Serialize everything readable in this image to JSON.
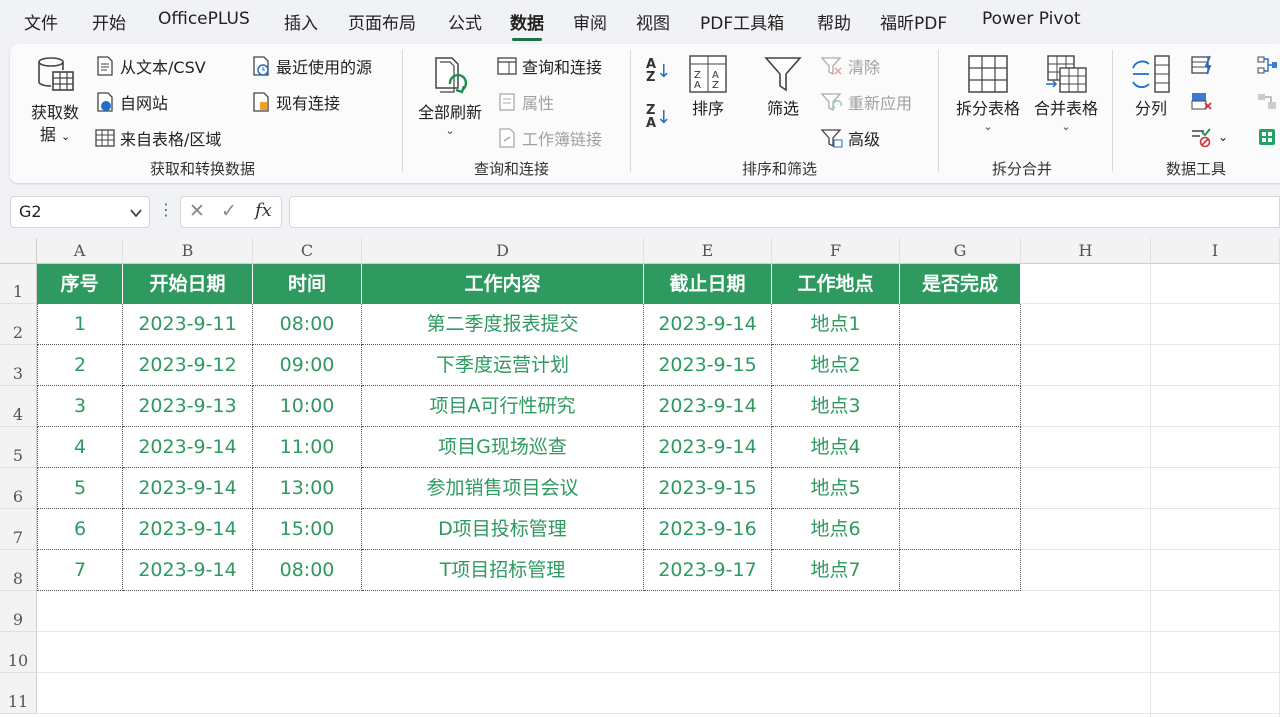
{
  "menu": [
    {
      "label": "文件"
    },
    {
      "label": "开始"
    },
    {
      "label": "OfficePLUS"
    },
    {
      "label": "插入"
    },
    {
      "label": "页面布局"
    },
    {
      "label": "公式"
    },
    {
      "label": "数据",
      "active": true
    },
    {
      "label": "审阅"
    },
    {
      "label": "视图"
    },
    {
      "label": "PDF工具箱"
    },
    {
      "label": "帮助"
    },
    {
      "label": "福昕PDF"
    },
    {
      "label": "Power Pivot"
    }
  ],
  "ribbon": {
    "get_data": {
      "big_line1": "获取数",
      "big_line2": "据",
      "from_text": "从文本/CSV",
      "from_web": "自网站",
      "from_table": "来自表格/区域",
      "recent_sources": "最近使用的源",
      "existing_connections": "现有连接",
      "group_label": "获取和转换数据"
    },
    "queries": {
      "refresh_all": "全部刷新",
      "queries_connections": "查询和连接",
      "properties": "属性",
      "workbook_links": "工作簿链接",
      "group_label": "查询和连接"
    },
    "sort_filter": {
      "sort": "排序",
      "filter": "筛选",
      "clear": "清除",
      "reapply": "重新应用",
      "advanced": "高级",
      "group_label": "排序和筛选"
    },
    "split_merge": {
      "split_table": "拆分表格",
      "merge_table": "合并表格",
      "group_label": "拆分合并"
    },
    "data_tools": {
      "text_to_columns": "分列",
      "group_label": "数据工具"
    }
  },
  "formula_bar": {
    "name_box": "G2",
    "fx": "fx",
    "formula": ""
  },
  "columns": [
    "A",
    "B",
    "C",
    "D",
    "E",
    "F",
    "G",
    "H",
    "I"
  ],
  "rows": [
    "1",
    "2",
    "3",
    "4",
    "5",
    "6",
    "7",
    "8",
    "9",
    "10",
    "11"
  ],
  "table": {
    "headers": [
      "序号",
      "开始日期",
      "时间",
      "工作内容",
      "截止日期",
      "工作地点",
      "是否完成"
    ],
    "rows": [
      [
        "1",
        "2023-9-11",
        "08:00",
        "第二季度报表提交",
        "2023-9-14",
        "地点1",
        ""
      ],
      [
        "2",
        "2023-9-12",
        "09:00",
        "下季度运营计划",
        "2023-9-15",
        "地点2",
        ""
      ],
      [
        "3",
        "2023-9-13",
        "10:00",
        "项目A可行性研究",
        "2023-9-14",
        "地点3",
        ""
      ],
      [
        "4",
        "2023-9-14",
        "11:00",
        "项目G现场巡查",
        "2023-9-14",
        "地点4",
        ""
      ],
      [
        "5",
        "2023-9-14",
        "13:00",
        "参加销售项目会议",
        "2023-9-15",
        "地点5",
        ""
      ],
      [
        "6",
        "2023-9-14",
        "15:00",
        "D项目投标管理",
        "2023-9-16",
        "地点6",
        ""
      ],
      [
        "7",
        "2023-9-14",
        "08:00",
        "T项目招标管理",
        "2023-9-17",
        "地点7",
        ""
      ]
    ]
  },
  "colors": {
    "accent": "#1e7145",
    "table_header": "#2e9a5f",
    "table_text": "#2e9a5f"
  }
}
